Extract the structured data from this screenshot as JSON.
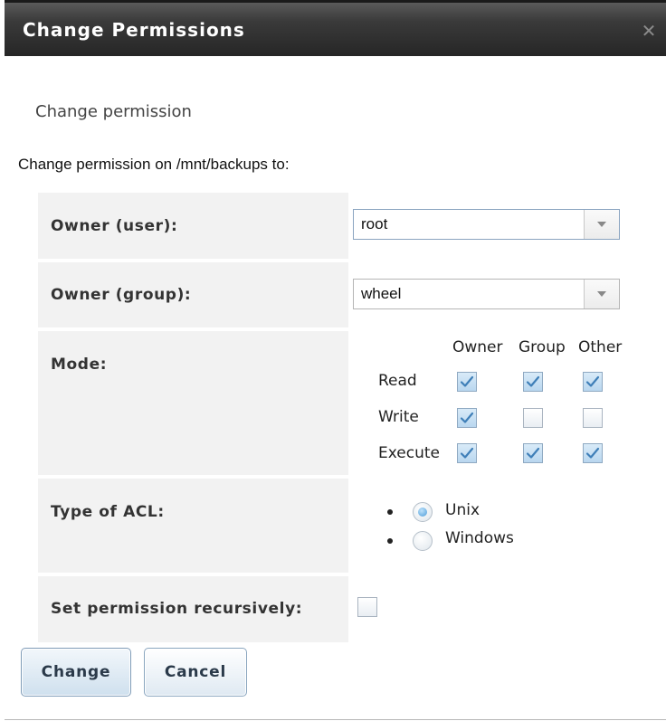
{
  "dialog": {
    "title": "Change Permissions",
    "close_icon": "close-icon"
  },
  "form": {
    "legend": "Change permission",
    "intro": "Change permission on /mnt/backups to:",
    "owner_user": {
      "label": "Owner (user):",
      "value": "root"
    },
    "owner_group": {
      "label": "Owner (group):",
      "value": "wheel"
    },
    "mode": {
      "label": "Mode:",
      "columns": [
        "Owner",
        "Group",
        "Other"
      ],
      "rows": [
        {
          "label": "Read",
          "owner": true,
          "group": true,
          "other": true
        },
        {
          "label": "Write",
          "owner": true,
          "group": false,
          "other": false
        },
        {
          "label": "Execute",
          "owner": true,
          "group": true,
          "other": true
        }
      ]
    },
    "acl": {
      "label": "Type of ACL:",
      "options": [
        "Unix",
        "Windows"
      ],
      "selected": "Unix"
    },
    "recursive": {
      "label": "Set permission recursively:",
      "checked": false
    }
  },
  "buttons": {
    "change": "Change",
    "cancel": "Cancel"
  },
  "colors": {
    "titlebar": "#2e2e2e",
    "label_bg": "#f2f2f2",
    "check_blue": "#4a9bd8"
  }
}
